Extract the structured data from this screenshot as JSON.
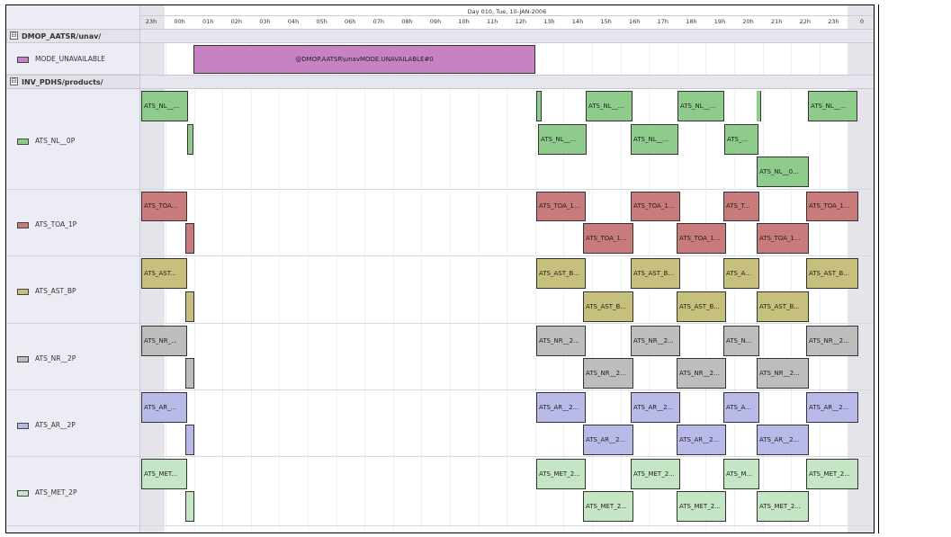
{
  "timeline": {
    "title": "Day 010, Tue, 10-JAN-2006",
    "hours": [
      "23h",
      "00h",
      "01h",
      "02h",
      "03h",
      "04h",
      "05h",
      "06h",
      "07h",
      "08h",
      "09h",
      "10h",
      "11h",
      "12h",
      "13h",
      "14h",
      "15h",
      "16h",
      "17h",
      "18h",
      "19h",
      "20h",
      "21h",
      "22h",
      "23h",
      "0"
    ]
  },
  "groups": [
    {
      "label": "DMOP_AATSR/unav/",
      "toggle": "⊟"
    },
    {
      "label": "INV_PDHS/products/",
      "toggle": "⊟"
    }
  ],
  "rows": [
    {
      "label": "MODE_UNAVAILABLE",
      "color": "#c782c4"
    },
    {
      "label": "ATS_NL__0P",
      "color": "#8fcc8c"
    },
    {
      "label": "ATS_TOA_1P",
      "color": "#c97a7a"
    },
    {
      "label": "ATS_AST_BP",
      "color": "#c6c07c"
    },
    {
      "label": "ATS_NR__2P",
      "color": "#bdbdbd"
    },
    {
      "label": "ATS_AR__2P",
      "color": "#babaea"
    },
    {
      "label": "ATS_MET_2P",
      "color": "#c4e6c4"
    }
  ],
  "mode_bar": {
    "label": "@DMOP.AATSR\\unavMODE.UNAVAILABLE#0"
  },
  "bars": {
    "nl": [
      "ATS_NL__...",
      "ATS_NL__...",
      "ATS_NL__...",
      "ATS_NL__...",
      "ATS_NL__...",
      "ATS_NL__...",
      "ATS_...",
      "ATS_NL__0..."
    ],
    "toa": [
      "ATS_TOA...",
      "ATS_TOA_1...",
      "ATS_TOA_1...",
      "ATS_T...",
      "ATS_TOA_1...",
      "ATS_TOA_1...",
      "ATS_TOA_1...",
      "ATS_TOA_1..."
    ],
    "ast": [
      "ATS_AST...",
      "ATS_AST_B...",
      "ATS_AST_B...",
      "ATS_A...",
      "ATS_AST_B...",
      "ATS_AST_B...",
      "ATS_AST_B...",
      "ATS_AST_B..."
    ],
    "nr": [
      "ATS_NR_...",
      "ATS_NR__2...",
      "ATS_NR__2...",
      "ATS_N...",
      "ATS_NR__2...",
      "ATS_NR__2...",
      "ATS_NR__2...",
      "ATS_NR__2..."
    ],
    "ar": [
      "ATS_AR_...",
      "ATS_AR__2...",
      "ATS_AR__2...",
      "ATS_A...",
      "ATS_AR__2...",
      "ATS_AR__2...",
      "ATS_AR__2...",
      "ATS_AR__2..."
    ],
    "met": [
      "ATS_MET...",
      "ATS_MET_2...",
      "ATS_MET_2...",
      "ATS_M...",
      "ATS_MET_2...",
      "ATS_MET_2...",
      "ATS_MET_2...",
      "ATS_MET_2..."
    ]
  }
}
